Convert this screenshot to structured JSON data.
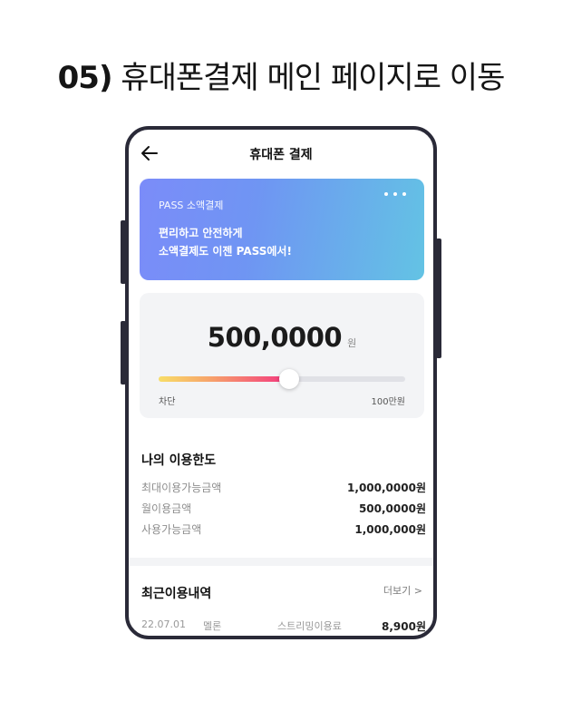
{
  "heading": {
    "number": "05)",
    "text": "휴대폰결제 메인 페이지로 이동"
  },
  "topbar": {
    "title": "휴대폰 결제"
  },
  "pass_card": {
    "subtitle": "PASS 소액결제",
    "line1": "편리하고 안전하게",
    "line2": "소액결제도 이젠 PASS에서!"
  },
  "limit": {
    "amount": "500,0000",
    "unit": "원",
    "slider_fraction": 0.53,
    "min_label": "차단",
    "max_label": "100만원"
  },
  "my_limit": {
    "title": "나의 이용한도",
    "rows": [
      {
        "label": "최대이용가능금액",
        "value": "1,000,0000원"
      },
      {
        "label": "월이용금액",
        "value": "500,0000원"
      },
      {
        "label": "사용가능금액",
        "value": "1,000,000원"
      }
    ]
  },
  "recent": {
    "title": "최근이용내역",
    "more_label": "더보기 >",
    "items": [
      {
        "date": "22.07.01",
        "merchant": "멜론",
        "type": "스트리밍이용료",
        "amount": "8,900원"
      }
    ]
  },
  "colors": {
    "card_gradient_start": "#7b8cf9",
    "card_gradient_end": "#63c3e4",
    "slider_start": "#f8de67",
    "slider_end": "#f3367f",
    "frame": "#2a2a38"
  },
  "icons": [
    "back-arrow-icon",
    "more-dots-icon"
  ]
}
